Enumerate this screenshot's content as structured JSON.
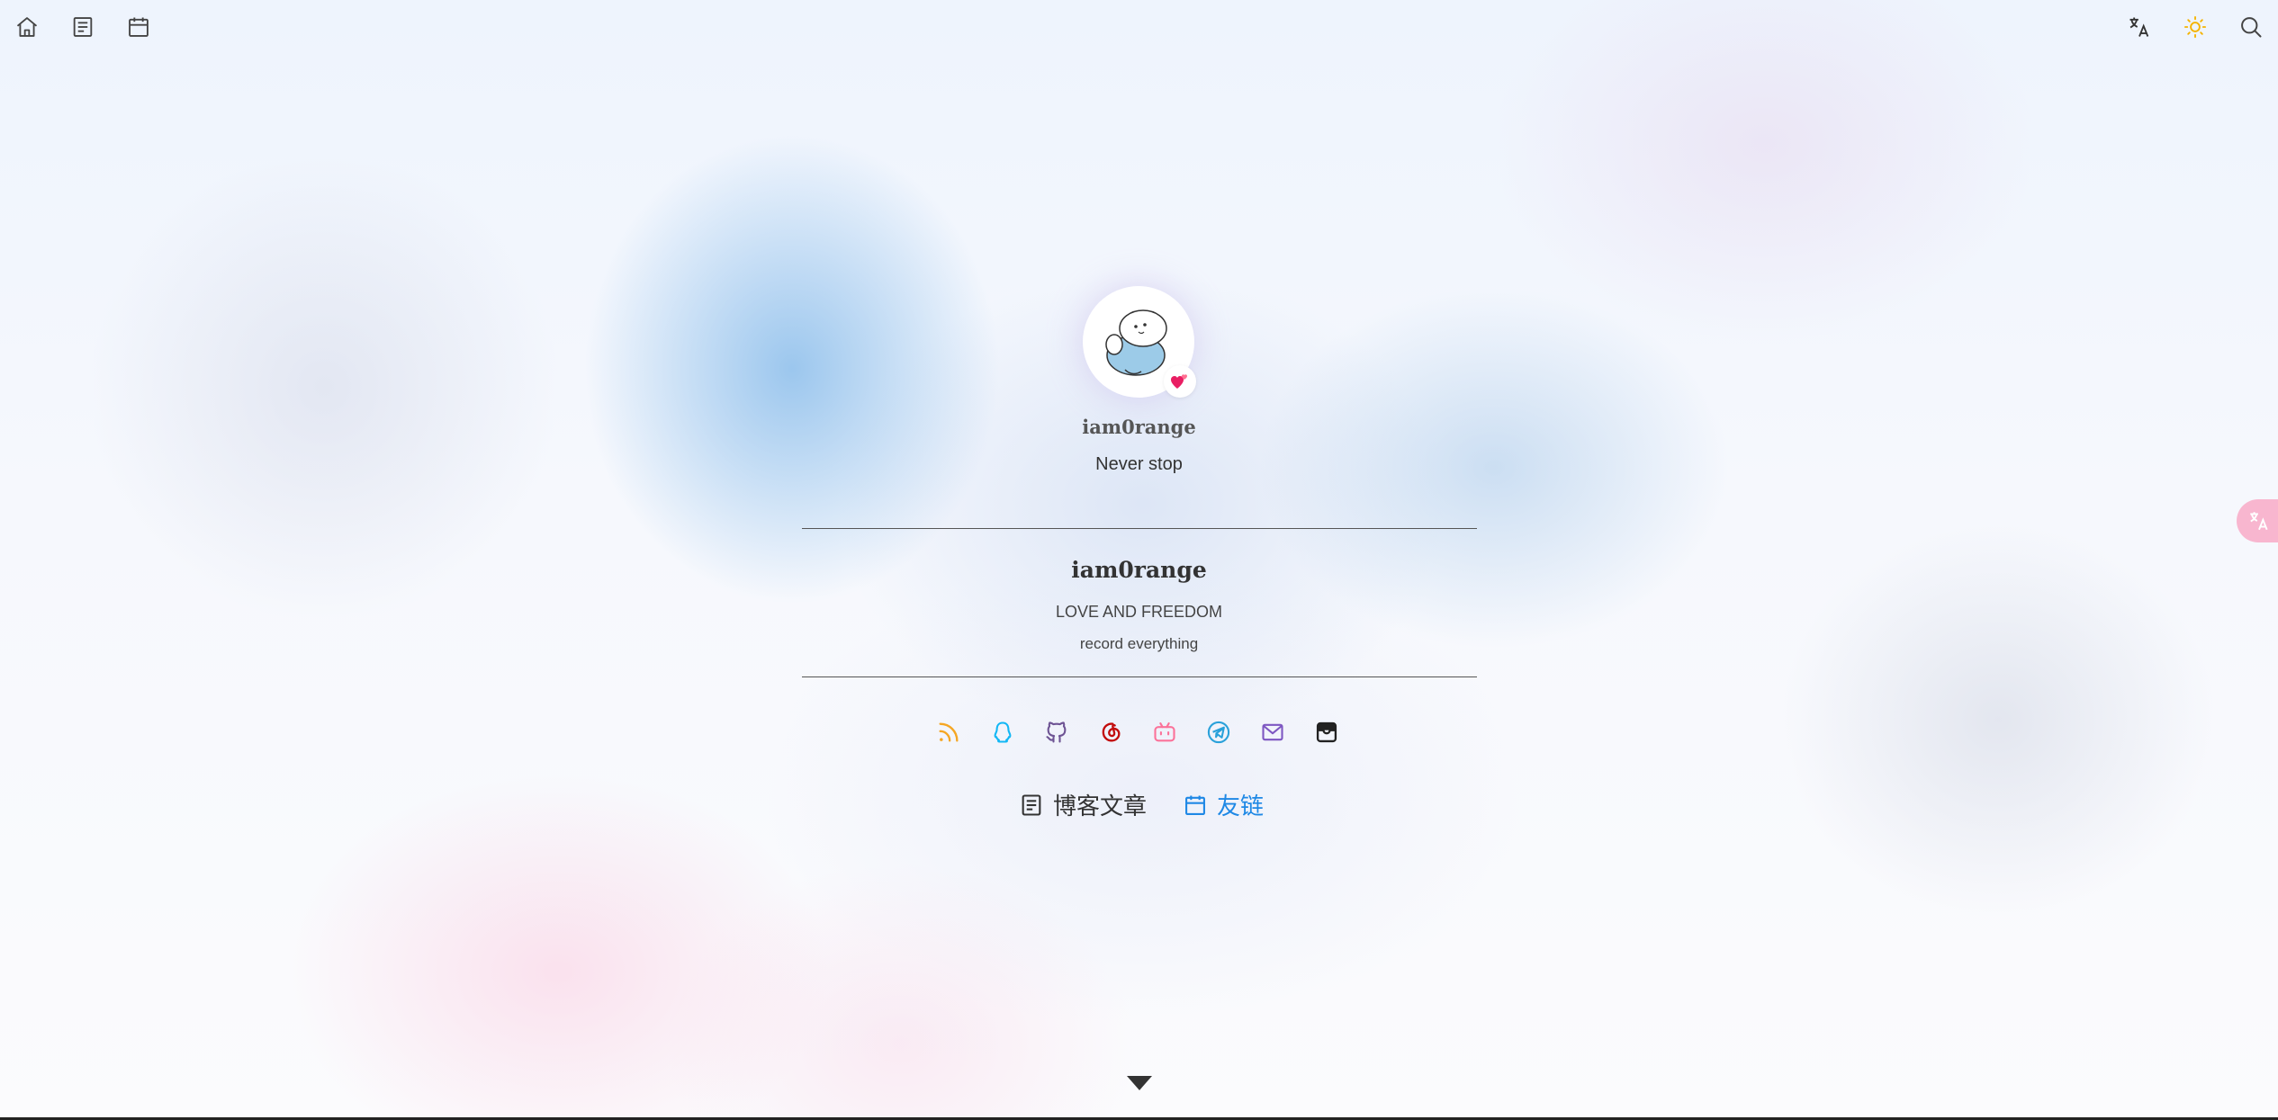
{
  "nav_left": [
    {
      "icon": "home-icon"
    },
    {
      "icon": "article-icon"
    },
    {
      "icon": "calendar-icon"
    }
  ],
  "nav_right": [
    {
      "icon": "translate-icon"
    },
    {
      "icon": "sun-icon"
    },
    {
      "icon": "search-icon"
    }
  ],
  "site": {
    "name": "iam0range",
    "motto": "Never stop"
  },
  "profile": {
    "name": "iam0range",
    "tagline": "LOVE AND FREEDOM",
    "subtitle": "record everything"
  },
  "social": [
    {
      "icon": "rss-icon",
      "color": "#f5a623"
    },
    {
      "icon": "qq-icon",
      "color": "#12b7f5"
    },
    {
      "icon": "github-icon",
      "color": "#6e5494"
    },
    {
      "icon": "netease-music-icon",
      "color": "#c20c0c"
    },
    {
      "icon": "bilibili-icon",
      "color": "#fb7299"
    },
    {
      "icon": "telegram-icon",
      "color": "#2aa1da"
    },
    {
      "icon": "email-icon",
      "color": "#7e57c2"
    },
    {
      "icon": "archive-icon",
      "color": "#222222"
    }
  ],
  "links": [
    {
      "label": "博客文章",
      "icon": "article-icon"
    },
    {
      "label": "友链",
      "icon": "calendar-icon"
    }
  ],
  "colors": {
    "accent": "#1e88e5",
    "side_button": "#f8b6cf"
  }
}
